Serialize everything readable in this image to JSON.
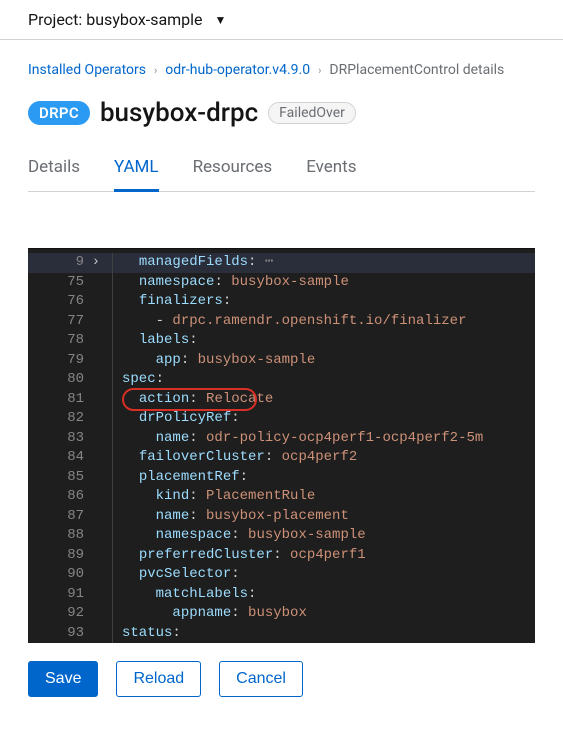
{
  "project": {
    "prefix": "Project:",
    "name": "busybox-sample"
  },
  "breadcrumb": {
    "installed_operators": "Installed Operators",
    "operator": "odr-hub-operator.v4.9.0",
    "detail": "DRPlacementControl details"
  },
  "header": {
    "badge": "DRPC",
    "title": "busybox-drpc",
    "status": "FailedOver"
  },
  "tabs": {
    "details": "Details",
    "yaml": "YAML",
    "resources": "Resources",
    "events": "Events"
  },
  "yaml": {
    "lines": [
      {
        "n": 9,
        "active": true,
        "ind": 1,
        "key": "managedFields",
        "fold": "⋯"
      },
      {
        "n": 75,
        "ind": 1,
        "key": "namespace",
        "val": "busybox-sample"
      },
      {
        "n": 76,
        "ind": 1,
        "key": "finalizers",
        "noval": true
      },
      {
        "n": 77,
        "ind": 2,
        "dash": true,
        "str": "drpc.ramendr.openshift.io/finalizer"
      },
      {
        "n": 78,
        "ind": 1,
        "key": "labels",
        "noval": true
      },
      {
        "n": 79,
        "ind": 2,
        "key": "app",
        "val": "busybox-sample"
      },
      {
        "n": 80,
        "ind": 0,
        "key": "spec",
        "noval": true
      },
      {
        "n": 81,
        "ind": 1,
        "key": "action",
        "val": "Relocate",
        "circled": true
      },
      {
        "n": 82,
        "ind": 1,
        "key": "drPolicyRef",
        "noval": true
      },
      {
        "n": 83,
        "ind": 2,
        "key": "name",
        "val": "odr-policy-ocp4perf1-ocp4perf2-5m"
      },
      {
        "n": 84,
        "ind": 1,
        "key": "failoverCluster",
        "val": "ocp4perf2"
      },
      {
        "n": 85,
        "ind": 1,
        "key": "placementRef",
        "noval": true
      },
      {
        "n": 86,
        "ind": 2,
        "key": "kind",
        "val": "PlacementRule"
      },
      {
        "n": 87,
        "ind": 2,
        "key": "name",
        "val": "busybox-placement"
      },
      {
        "n": 88,
        "ind": 2,
        "key": "namespace",
        "val": "busybox-sample"
      },
      {
        "n": 89,
        "ind": 1,
        "key": "preferredCluster",
        "val": "ocp4perf1"
      },
      {
        "n": 90,
        "ind": 1,
        "key": "pvcSelector",
        "noval": true
      },
      {
        "n": 91,
        "ind": 2,
        "key": "matchLabels",
        "noval": true
      },
      {
        "n": 92,
        "ind": 3,
        "key": "appname",
        "val": "busybox"
      },
      {
        "n": 93,
        "ind": 0,
        "key": "status",
        "noval": true
      }
    ]
  },
  "buttons": {
    "save": "Save",
    "reload": "Reload",
    "cancel": "Cancel"
  }
}
